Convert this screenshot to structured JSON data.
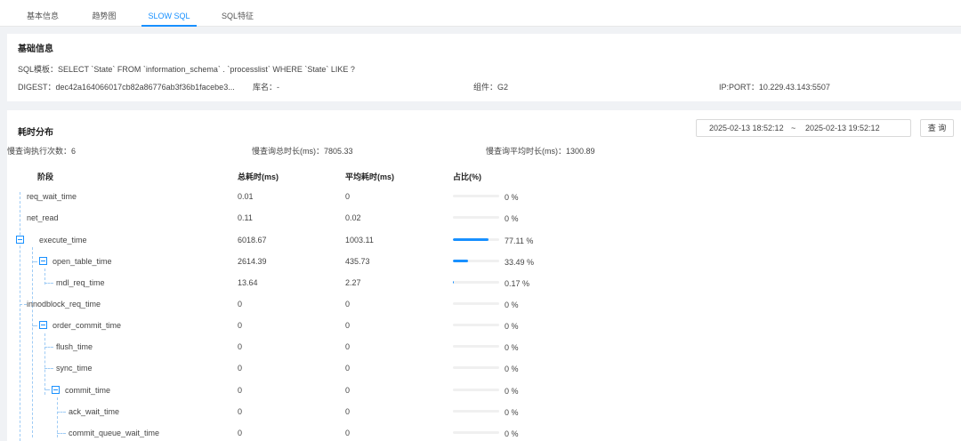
{
  "tabs": [
    {
      "label": "基本信息",
      "active": false
    },
    {
      "label": "趋势图",
      "active": false
    },
    {
      "label": "SLOW SQL",
      "active": true
    },
    {
      "label": "SQL特征",
      "active": false
    }
  ],
  "basic": {
    "title": "基础信息",
    "sql_template": "SQL模板：SELECT `State` FROM `information_schema` . `processlist` WHERE `State` LIKE ?",
    "digest": "DIGEST：dec42a164066017cb82a86776ab3f36b1facebe3...",
    "db": "库名：-",
    "component": "组件：G2",
    "ipport": "IP:PORT：10.229.43.143:5507"
  },
  "dist": {
    "title": "耗时分布",
    "date_start": "2025-02-13 18:52:12",
    "date_sep": "~",
    "date_end": "2025-02-13 19:52:12",
    "query_label": "查 询",
    "exec_count": "慢查询执行次数：6",
    "total_duration": "慢查询总时长(ms)：7805.33",
    "avg_duration": "慢查询平均时长(ms)：1300.89",
    "headers": {
      "stage": "阶段",
      "total": "总耗时(ms)",
      "avg": "平均耗时(ms)",
      "ratio": "占比(%)"
    },
    "rows": [
      {
        "name": "req_wait_time",
        "total": "0.01",
        "avg": "0",
        "pct": 0,
        "pct_label": "0 %"
      },
      {
        "name": "net_read",
        "total": "0.11",
        "avg": "0.02",
        "pct": 0,
        "pct_label": "0 %"
      },
      {
        "name": "execute_time",
        "total": "6018.67",
        "avg": "1003.11",
        "pct": 77.11,
        "pct_label": "77.11 %"
      },
      {
        "name": "open_table_time",
        "total": "2614.39",
        "avg": "435.73",
        "pct": 33.49,
        "pct_label": "33.49 %"
      },
      {
        "name": "mdl_req_time",
        "total": "13.64",
        "avg": "2.27",
        "pct": 0.17,
        "pct_label": "0.17 %"
      },
      {
        "name": "innodblock_req_time",
        "total": "0",
        "avg": "0",
        "pct": 0,
        "pct_label": "0 %"
      },
      {
        "name": "order_commit_time",
        "total": "0",
        "avg": "0",
        "pct": 0,
        "pct_label": "0 %"
      },
      {
        "name": "flush_time",
        "total": "0",
        "avg": "0",
        "pct": 0,
        "pct_label": "0 %"
      },
      {
        "name": "sync_time",
        "total": "0",
        "avg": "0",
        "pct": 0,
        "pct_label": "0 %"
      },
      {
        "name": "commit_time",
        "total": "0",
        "avg": "0",
        "pct": 0,
        "pct_label": "0 %"
      },
      {
        "name": "ack_wait_time",
        "total": "0",
        "avg": "0",
        "pct": 0,
        "pct_label": "0 %"
      },
      {
        "name": "commit_queue_wait_time",
        "total": "0",
        "avg": "0",
        "pct": 0,
        "pct_label": "0 %"
      }
    ]
  },
  "colors": {
    "accent": "#1890ff",
    "track": "#f0f0f0"
  },
  "icons": {
    "tree_toggle": "minus-square-icon"
  }
}
